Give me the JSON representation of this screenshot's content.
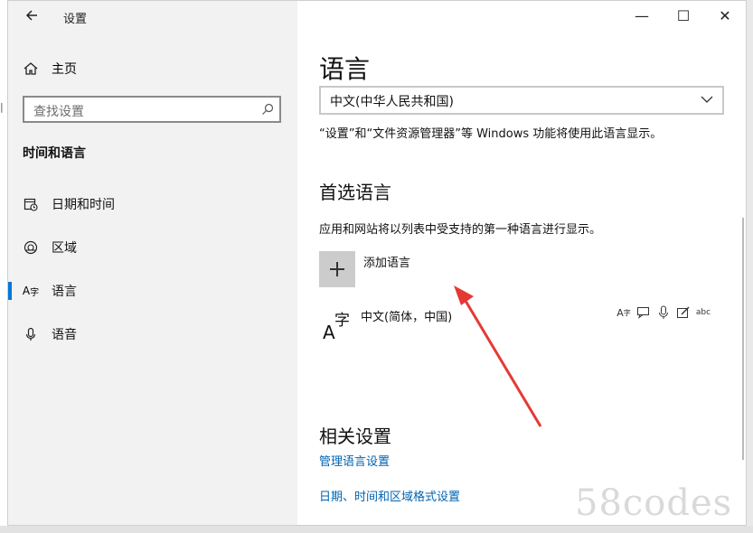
{
  "window": {
    "app_title": "设置",
    "controls": {
      "minimize": "—",
      "maximize": "☐",
      "close": "✕"
    }
  },
  "sidebar": {
    "home_label": "主页",
    "search_placeholder": "查找设置",
    "section_title": "时间和语言",
    "items": [
      {
        "label": "日期和时间",
        "icon": "calendar-clock-icon"
      },
      {
        "label": "区域",
        "icon": "globe-icon"
      },
      {
        "label": "语言",
        "icon": "language-icon",
        "active": true
      },
      {
        "label": "语音",
        "icon": "microphone-icon"
      }
    ]
  },
  "main": {
    "title": "语言",
    "display_language": "中文(中华人民共和国)",
    "display_language_desc": "“设置”和“文件资源管理器”等 Windows 功能将使用此语言显示。",
    "preferred_heading": "首选语言",
    "preferred_desc": "应用和网站将以列表中受支持的第一种语言进行显示。",
    "add_language_label": "添加语言",
    "language_entry": {
      "name": "中文(简体，中国)",
      "feature_icons": [
        "display-language-icon",
        "speech-bubble-icon",
        "microphone-icon",
        "handwriting-icon",
        "spell-check-icon"
      ]
    },
    "related_heading": "相关设置",
    "links": [
      "管理语言设置",
      "日期、时间和区域格式设置"
    ]
  },
  "watermark": "58codes",
  "colors": {
    "accent": "#0078d7",
    "link": "#0063b1",
    "annotation_arrow": "#e53935"
  }
}
